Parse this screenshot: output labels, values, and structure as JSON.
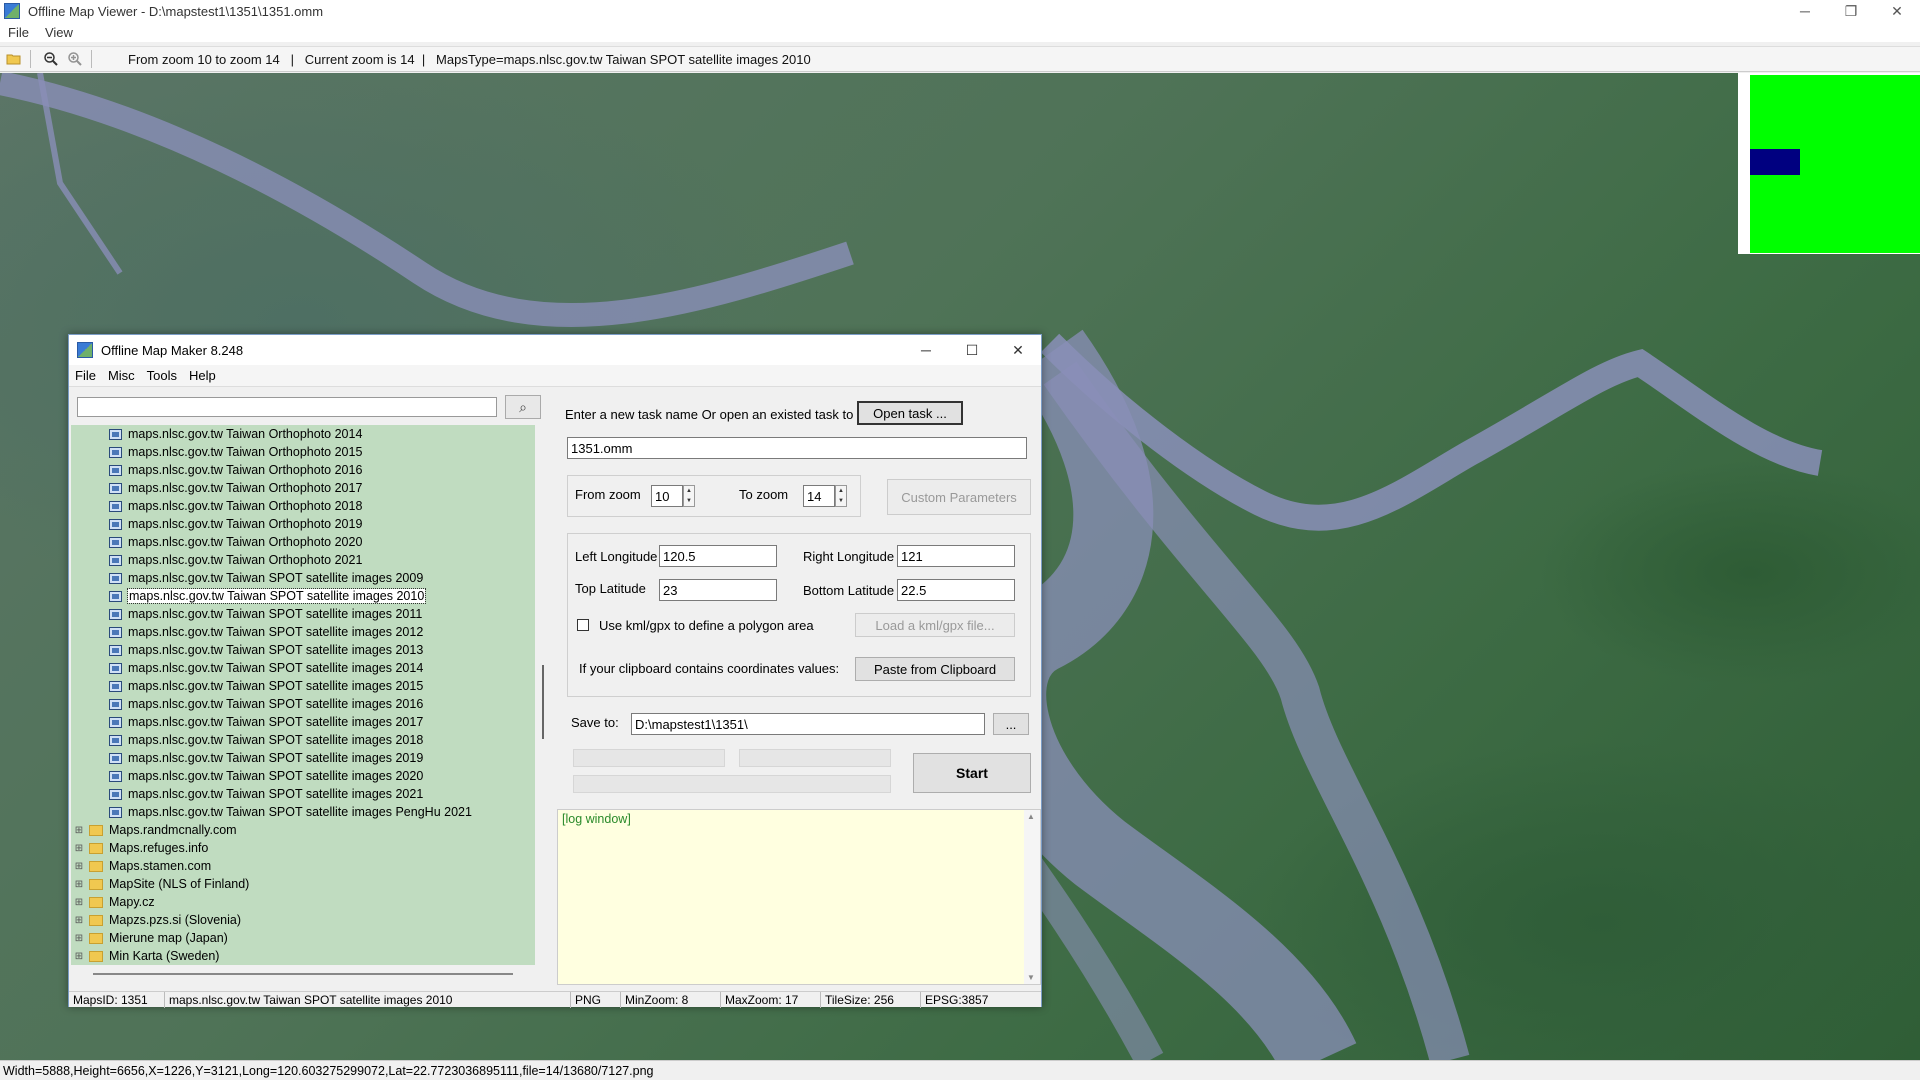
{
  "window": {
    "title": "Offline Map Viewer - D:\\mapstest1\\1351\\1351.omm",
    "minimize": "─",
    "restore": "❐",
    "close": "✕"
  },
  "menubar": [
    "File",
    "View"
  ],
  "toolbar": {
    "open_icon": "📂",
    "zoom_out_icon": "🔍",
    "zoom_in_icon": "🔍",
    "info": "From zoom 10 to zoom 14   |   Current zoom is 14  |   MapsType=maps.nlsc.gov.tw Taiwan SPOT satellite images 2010"
  },
  "status_bar": "Width=5888,Height=6656,X=1226,Y=3121,Long=120.603275299072,Lat=22.7723036895111,file=14/13680/7127.png",
  "dialog": {
    "title": "Offline Map Maker 8.248",
    "minimize": "─",
    "maximize": "☐",
    "close": "✕",
    "menu": [
      "File",
      "Misc",
      "Tools",
      "Help"
    ],
    "search_placeholder": "",
    "search_icon": "⌕",
    "tree_items": [
      {
        "label": "maps.nlsc.gov.tw Taiwan Orthophoto 2014",
        "type": "map"
      },
      {
        "label": "maps.nlsc.gov.tw Taiwan Orthophoto 2015",
        "type": "map"
      },
      {
        "label": "maps.nlsc.gov.tw Taiwan Orthophoto 2016",
        "type": "map"
      },
      {
        "label": "maps.nlsc.gov.tw Taiwan Orthophoto 2017",
        "type": "map"
      },
      {
        "label": "maps.nlsc.gov.tw Taiwan Orthophoto 2018",
        "type": "map"
      },
      {
        "label": "maps.nlsc.gov.tw Taiwan Orthophoto 2019",
        "type": "map"
      },
      {
        "label": "maps.nlsc.gov.tw Taiwan Orthophoto 2020",
        "type": "map"
      },
      {
        "label": "maps.nlsc.gov.tw Taiwan Orthophoto 2021",
        "type": "map"
      },
      {
        "label": "maps.nlsc.gov.tw Taiwan SPOT satellite images 2009",
        "type": "map"
      },
      {
        "label": "maps.nlsc.gov.tw Taiwan SPOT satellite images 2010",
        "type": "map",
        "selected": true
      },
      {
        "label": "maps.nlsc.gov.tw Taiwan SPOT satellite images 2011",
        "type": "map"
      },
      {
        "label": "maps.nlsc.gov.tw Taiwan SPOT satellite images 2012",
        "type": "map"
      },
      {
        "label": "maps.nlsc.gov.tw Taiwan SPOT satellite images 2013",
        "type": "map"
      },
      {
        "label": "maps.nlsc.gov.tw Taiwan SPOT satellite images 2014",
        "type": "map"
      },
      {
        "label": "maps.nlsc.gov.tw Taiwan SPOT satellite images 2015",
        "type": "map"
      },
      {
        "label": "maps.nlsc.gov.tw Taiwan SPOT satellite images 2016",
        "type": "map"
      },
      {
        "label": "maps.nlsc.gov.tw Taiwan SPOT satellite images 2017",
        "type": "map"
      },
      {
        "label": "maps.nlsc.gov.tw Taiwan SPOT satellite images 2018",
        "type": "map"
      },
      {
        "label": "maps.nlsc.gov.tw Taiwan SPOT satellite images 2019",
        "type": "map"
      },
      {
        "label": "maps.nlsc.gov.tw Taiwan SPOT satellite images 2020",
        "type": "map"
      },
      {
        "label": "maps.nlsc.gov.tw Taiwan SPOT satellite images 2021",
        "type": "map"
      },
      {
        "label": "maps.nlsc.gov.tw Taiwan SPOT satellite images PengHu 2021",
        "type": "map"
      },
      {
        "label": "Maps.randmcnally.com",
        "type": "folder"
      },
      {
        "label": "Maps.refuges.info",
        "type": "folder"
      },
      {
        "label": "Maps.stamen.com",
        "type": "folder"
      },
      {
        "label": "MapSite (NLS of Finland)",
        "type": "folder"
      },
      {
        "label": "Mapy.cz",
        "type": "folder"
      },
      {
        "label": "Mapzs.pzs.si (Slovenia)",
        "type": "folder"
      },
      {
        "label": "Mierune map (Japan)",
        "type": "folder"
      },
      {
        "label": "Min Karta (Sweden)",
        "type": "folder"
      }
    ],
    "task_prompt": "Enter a new task name Or open an existed task to continue:",
    "open_task": "Open task ...",
    "task_name": "1351.omm",
    "from_zoom_label": "From zoom",
    "from_zoom": "10",
    "to_zoom_label": "To zoom",
    "to_zoom": "14",
    "custom_params": "Custom Parameters",
    "left_lon_label": "Left Longitude",
    "left_lon": "120.5",
    "right_lon_label": "Right Longitude",
    "right_lon": "121",
    "top_lat_label": "Top Latitude",
    "top_lat": "23",
    "bottom_lat_label": "Bottom Latitude",
    "bottom_lat": "22.5",
    "kml_label": "Use kml/gpx to define a polygon area",
    "load_kml": "Load a kml/gpx file...",
    "clipboard_label": "If your clipboard contains coordinates values:",
    "paste_clipboard": "Paste from Clipboard",
    "save_to_label": "Save to:",
    "save_to": "D:\\mapstest1\\1351\\",
    "browse": "...",
    "start": "Start",
    "log": "[log window]",
    "spin_up": "▲",
    "spin_down": "▼",
    "scroll_up": "▲",
    "scroll_down": "▼",
    "status": {
      "maps_id": "MapsID: 1351",
      "maps_name": "maps.nlsc.gov.tw Taiwan SPOT satellite images 2010",
      "format": "PNG",
      "min_zoom": "MinZoom: 8",
      "max_zoom": "MaxZoom: 17",
      "tile_size": "TileSize: 256",
      "epsg": "EPSG:3857"
    }
  }
}
